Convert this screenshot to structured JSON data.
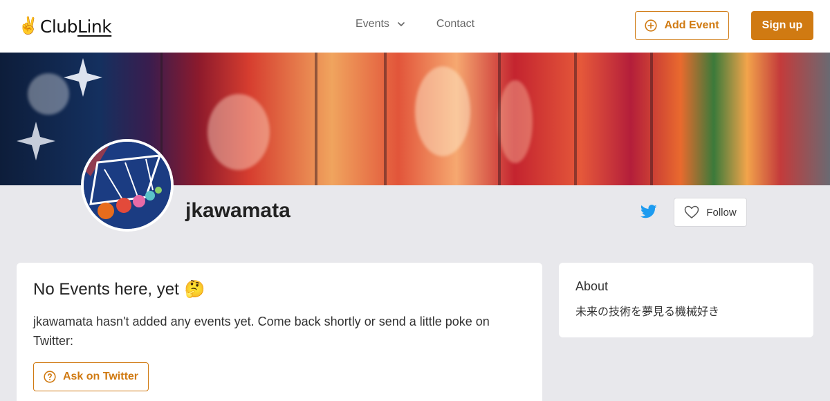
{
  "brand": {
    "logo_prefix": "Club",
    "logo_suffix": "Link"
  },
  "nav": {
    "events_label": "Events",
    "contact_label": "Contact"
  },
  "actions": {
    "add_event_label": "Add Event",
    "signup_label": "Sign up"
  },
  "profile": {
    "username": "jkawamata",
    "follow_label": "Follow"
  },
  "events_card": {
    "title": "No Events here, yet",
    "emoji": "🤔",
    "message": "jkawamata hasn't added any events yet. Come back shortly or send a little poke on Twitter:",
    "ask_button_label": "Ask on Twitter"
  },
  "about_card": {
    "title": "About",
    "text": "未来の技術を夢見る機械好き"
  },
  "colors": {
    "accent": "#d07a12",
    "twitter": "#1d9bf0",
    "page_background": "#e8e8ec"
  }
}
